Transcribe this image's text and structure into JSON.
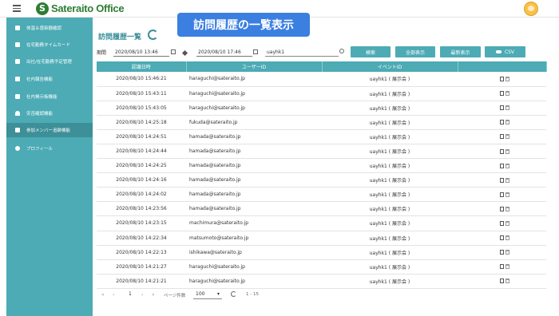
{
  "app": {
    "logo_letter": "S",
    "logo_text": "Sateraito Office"
  },
  "banner": "訪問履歴の一覧表示",
  "page_title": "訪問履歴一覧",
  "sidebar": {
    "items": [
      {
        "label": "体温＆感染器確認"
      },
      {
        "label": "在宅勤務タイムカード"
      },
      {
        "label": "出社/在宅勤務予定管理"
      },
      {
        "label": "社内報告機能"
      },
      {
        "label": "社内掲示板機能"
      },
      {
        "label": "安否確認機能"
      },
      {
        "label": "参加メンバー追跡機能"
      },
      {
        "label": "プロフィール"
      }
    ]
  },
  "filters": {
    "period_label": "期間",
    "date_from": "2020/08/10 13:46",
    "date_to": "2020/08/10 17:46",
    "keyword": "uayhk1"
  },
  "buttons": {
    "search": "検索",
    "show_all": "全部表示",
    "latest": "最新表示",
    "csv": "CSV"
  },
  "table": {
    "headers": [
      "認識日時",
      "ユーザーID",
      "イベントID",
      ""
    ],
    "rows": [
      [
        "2020/08/10 15:46:21",
        "haraguchi@sateraito.jp",
        "uayhk1 ( 展示会 )"
      ],
      [
        "2020/08/10 15:43:11",
        "haraguchi@sateraito.jp",
        "uayhk1 ( 展示会 )"
      ],
      [
        "2020/08/10 15:43:05",
        "haraguchi@sateraito.jp",
        "uayhk1 ( 展示会 )"
      ],
      [
        "2020/08/10 14:25:18",
        "fukuda@sateraito.jp",
        "uayhk1 ( 展示会 )"
      ],
      [
        "2020/08/10 14:24:51",
        "hamada@sateraito.jp",
        "uayhk1 ( 展示会 )"
      ],
      [
        "2020/08/10 14:24:44",
        "hamada@sateraito.jp",
        "uayhk1 ( 展示会 )"
      ],
      [
        "2020/08/10 14:24:25",
        "hamada@sateraito.jp",
        "uayhk1 ( 展示会 )"
      ],
      [
        "2020/08/10 14:24:16",
        "hamada@sateraito.jp",
        "uayhk1 ( 展示会 )"
      ],
      [
        "2020/08/10 14:24:02",
        "hamada@sateraito.jp",
        "uayhk1 ( 展示会 )"
      ],
      [
        "2020/08/10 14:23:56",
        "hamada@sateraito.jp",
        "uayhk1 ( 展示会 )"
      ],
      [
        "2020/08/10 14:23:15",
        "machimura@sateraito.jp",
        "uayhk1 ( 展示会 )"
      ],
      [
        "2020/08/10 14:22:34",
        "matsumoto@sateraito.jp",
        "uayhk1 ( 展示会 )"
      ],
      [
        "2020/08/10 14:22:13",
        "ishikawa@sateraito.jp",
        "uayhk1 ( 展示会 )"
      ],
      [
        "2020/08/10 14:21:27",
        "haraguchi@sateraito.jp",
        "uayhk1 ( 展示会 )"
      ],
      [
        "2020/08/10 14:21:21",
        "haraguchi@sateraito.jp",
        "uayhk1 ( 展示会 )"
      ]
    ]
  },
  "pager": {
    "first": "«",
    "prev": "‹",
    "page": "1",
    "next": "›",
    "last": "»",
    "per_page_label": "ページ件数",
    "per_page": "100",
    "range": "1 - 15"
  },
  "icons": {
    "menu": "hamburger-icon",
    "refresh": "refresh-icon",
    "calendar": "calendar-icon",
    "search": "search-icon",
    "cloud": "cloud-download-icon",
    "doc": "document-icon",
    "trash": "trash-icon"
  }
}
